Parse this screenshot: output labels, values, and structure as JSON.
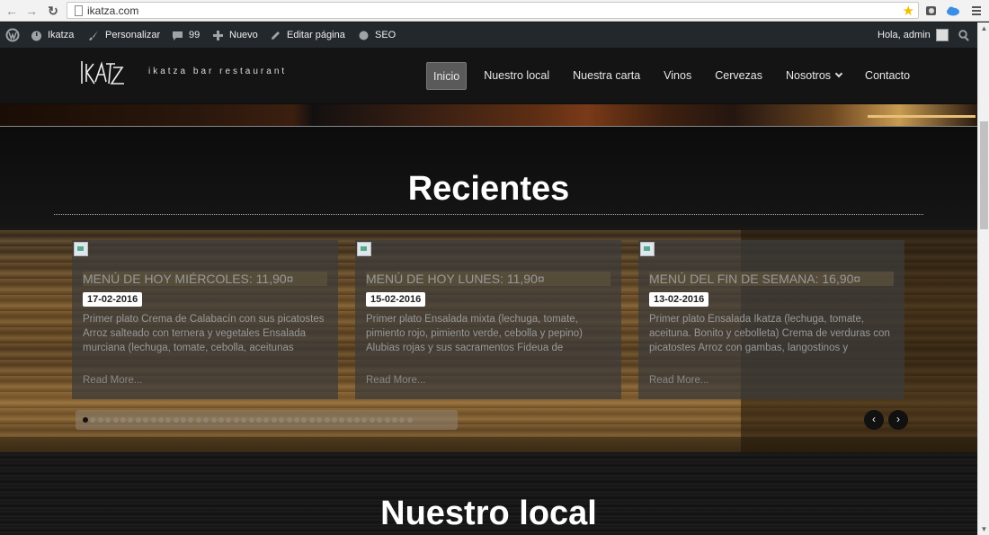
{
  "browser": {
    "url": "ikatza.com"
  },
  "admin_bar": {
    "site_name": "Ikatza",
    "customize": "Personalizar",
    "comments_count": "99",
    "new": "Nuevo",
    "edit_page": "Editar página",
    "seo": "SEO",
    "greeting": "Hola, admin"
  },
  "header": {
    "tagline": "ikatza bar restaurant",
    "nav": [
      "Inicio",
      "Nuestro local",
      "Nuestra carta",
      "Vinos",
      "Cervezas",
      "Nosotros",
      "Contacto"
    ]
  },
  "recientes": {
    "title": "Recientes",
    "cards": [
      {
        "title": "MENÚ DE HOY MIÉRCOLES: 11,90¤",
        "date": "17-02-2016",
        "excerpt": "Primer plato Crema de Calabacín con sus picatostes Arroz salteado con ternera y vegetales Ensalada murciana (lechuga, tomate, cebolla, aceitunas",
        "more": "Read More..."
      },
      {
        "title": "MENÚ DE HOY LUNES: 11,90¤",
        "date": "15-02-2016",
        "excerpt": "Primer plato Ensalada mixta (lechuga, tomate, pimiento rojo, pimiento verde, cebolla y pepino) Alubias rojas y sus sacramentos Fideua de",
        "more": "Read More..."
      },
      {
        "title": "MENÚ DEL FIN DE SEMANA: 16,90¤",
        "date": "13-02-2016",
        "excerpt": "Primer plato Ensalada Ikatza (lechuga, tomate, aceituna. Bonito y cebolleta) Crema de verduras con picatostes Arroz con gambas, langostinos y",
        "more": "Read More..."
      }
    ],
    "pager_count": 44,
    "prev": "‹",
    "next": "›"
  },
  "nuestro_local": {
    "title": "Nuestro local"
  }
}
